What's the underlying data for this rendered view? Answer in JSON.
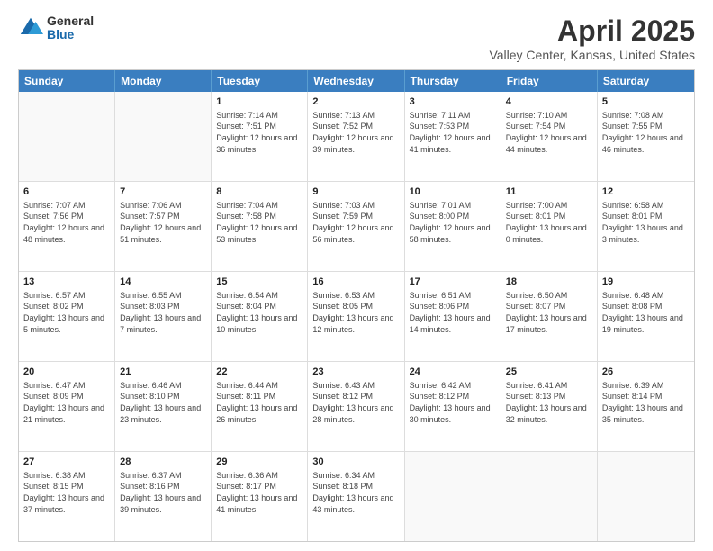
{
  "header": {
    "logo_general": "General",
    "logo_blue": "Blue",
    "main_title": "April 2025",
    "subtitle": "Valley Center, Kansas, United States"
  },
  "calendar": {
    "days_of_week": [
      "Sunday",
      "Monday",
      "Tuesday",
      "Wednesday",
      "Thursday",
      "Friday",
      "Saturday"
    ],
    "rows": [
      [
        {
          "day": "",
          "info": ""
        },
        {
          "day": "",
          "info": ""
        },
        {
          "day": "1",
          "info": "Sunrise: 7:14 AM\nSunset: 7:51 PM\nDaylight: 12 hours and 36 minutes."
        },
        {
          "day": "2",
          "info": "Sunrise: 7:13 AM\nSunset: 7:52 PM\nDaylight: 12 hours and 39 minutes."
        },
        {
          "day": "3",
          "info": "Sunrise: 7:11 AM\nSunset: 7:53 PM\nDaylight: 12 hours and 41 minutes."
        },
        {
          "day": "4",
          "info": "Sunrise: 7:10 AM\nSunset: 7:54 PM\nDaylight: 12 hours and 44 minutes."
        },
        {
          "day": "5",
          "info": "Sunrise: 7:08 AM\nSunset: 7:55 PM\nDaylight: 12 hours and 46 minutes."
        }
      ],
      [
        {
          "day": "6",
          "info": "Sunrise: 7:07 AM\nSunset: 7:56 PM\nDaylight: 12 hours and 48 minutes."
        },
        {
          "day": "7",
          "info": "Sunrise: 7:06 AM\nSunset: 7:57 PM\nDaylight: 12 hours and 51 minutes."
        },
        {
          "day": "8",
          "info": "Sunrise: 7:04 AM\nSunset: 7:58 PM\nDaylight: 12 hours and 53 minutes."
        },
        {
          "day": "9",
          "info": "Sunrise: 7:03 AM\nSunset: 7:59 PM\nDaylight: 12 hours and 56 minutes."
        },
        {
          "day": "10",
          "info": "Sunrise: 7:01 AM\nSunset: 8:00 PM\nDaylight: 12 hours and 58 minutes."
        },
        {
          "day": "11",
          "info": "Sunrise: 7:00 AM\nSunset: 8:01 PM\nDaylight: 13 hours and 0 minutes."
        },
        {
          "day": "12",
          "info": "Sunrise: 6:58 AM\nSunset: 8:01 PM\nDaylight: 13 hours and 3 minutes."
        }
      ],
      [
        {
          "day": "13",
          "info": "Sunrise: 6:57 AM\nSunset: 8:02 PM\nDaylight: 13 hours and 5 minutes."
        },
        {
          "day": "14",
          "info": "Sunrise: 6:55 AM\nSunset: 8:03 PM\nDaylight: 13 hours and 7 minutes."
        },
        {
          "day": "15",
          "info": "Sunrise: 6:54 AM\nSunset: 8:04 PM\nDaylight: 13 hours and 10 minutes."
        },
        {
          "day": "16",
          "info": "Sunrise: 6:53 AM\nSunset: 8:05 PM\nDaylight: 13 hours and 12 minutes."
        },
        {
          "day": "17",
          "info": "Sunrise: 6:51 AM\nSunset: 8:06 PM\nDaylight: 13 hours and 14 minutes."
        },
        {
          "day": "18",
          "info": "Sunrise: 6:50 AM\nSunset: 8:07 PM\nDaylight: 13 hours and 17 minutes."
        },
        {
          "day": "19",
          "info": "Sunrise: 6:48 AM\nSunset: 8:08 PM\nDaylight: 13 hours and 19 minutes."
        }
      ],
      [
        {
          "day": "20",
          "info": "Sunrise: 6:47 AM\nSunset: 8:09 PM\nDaylight: 13 hours and 21 minutes."
        },
        {
          "day": "21",
          "info": "Sunrise: 6:46 AM\nSunset: 8:10 PM\nDaylight: 13 hours and 23 minutes."
        },
        {
          "day": "22",
          "info": "Sunrise: 6:44 AM\nSunset: 8:11 PM\nDaylight: 13 hours and 26 minutes."
        },
        {
          "day": "23",
          "info": "Sunrise: 6:43 AM\nSunset: 8:12 PM\nDaylight: 13 hours and 28 minutes."
        },
        {
          "day": "24",
          "info": "Sunrise: 6:42 AM\nSunset: 8:12 PM\nDaylight: 13 hours and 30 minutes."
        },
        {
          "day": "25",
          "info": "Sunrise: 6:41 AM\nSunset: 8:13 PM\nDaylight: 13 hours and 32 minutes."
        },
        {
          "day": "26",
          "info": "Sunrise: 6:39 AM\nSunset: 8:14 PM\nDaylight: 13 hours and 35 minutes."
        }
      ],
      [
        {
          "day": "27",
          "info": "Sunrise: 6:38 AM\nSunset: 8:15 PM\nDaylight: 13 hours and 37 minutes."
        },
        {
          "day": "28",
          "info": "Sunrise: 6:37 AM\nSunset: 8:16 PM\nDaylight: 13 hours and 39 minutes."
        },
        {
          "day": "29",
          "info": "Sunrise: 6:36 AM\nSunset: 8:17 PM\nDaylight: 13 hours and 41 minutes."
        },
        {
          "day": "30",
          "info": "Sunrise: 6:34 AM\nSunset: 8:18 PM\nDaylight: 13 hours and 43 minutes."
        },
        {
          "day": "",
          "info": ""
        },
        {
          "day": "",
          "info": ""
        },
        {
          "day": "",
          "info": ""
        }
      ]
    ]
  }
}
